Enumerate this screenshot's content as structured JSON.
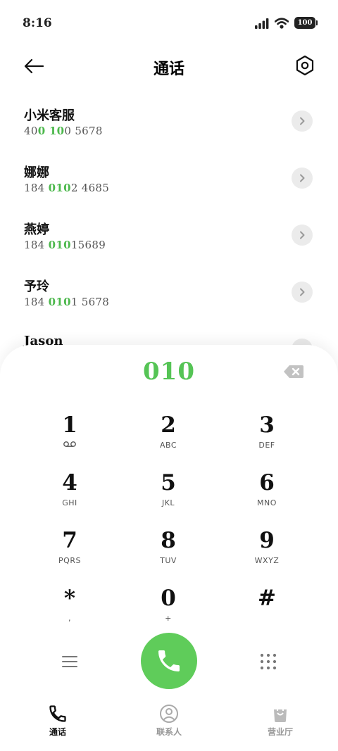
{
  "status_bar": {
    "time": "8:16",
    "battery": "100"
  },
  "header": {
    "title": "通话"
  },
  "results": [
    {
      "name": "小米客服",
      "number_pre": "40",
      "number_match": "0 10",
      "number_post": "0 5678"
    },
    {
      "name": "娜娜",
      "number_pre": "184 ",
      "number_match": "010",
      "number_post": "2 4685"
    },
    {
      "name": "燕婷",
      "number_pre": "184 ",
      "number_match": "010",
      "number_post": "15689"
    },
    {
      "name": "予玲",
      "number_pre": "184 ",
      "number_match": "010",
      "number_post": "1 5678"
    },
    {
      "name": "Jason",
      "number_pre": "",
      "number_match": "",
      "number_post": ""
    }
  ],
  "dialer": {
    "input": "010"
  },
  "keypad": [
    {
      "digit": "1",
      "letters": ""
    },
    {
      "digit": "2",
      "letters": "ABC"
    },
    {
      "digit": "3",
      "letters": "DEF"
    },
    {
      "digit": "4",
      "letters": "GHI"
    },
    {
      "digit": "5",
      "letters": "JKL"
    },
    {
      "digit": "6",
      "letters": "MNO"
    },
    {
      "digit": "7",
      "letters": "PQRS"
    },
    {
      "digit": "8",
      "letters": "TUV"
    },
    {
      "digit": "9",
      "letters": "WXYZ"
    },
    {
      "digit": "*",
      "letters": ","
    },
    {
      "digit": "0",
      "letters": "+"
    },
    {
      "digit": "#",
      "letters": ""
    }
  ],
  "tabs": [
    {
      "label": "通话",
      "icon": "phone-icon",
      "active": true
    },
    {
      "label": "联系人",
      "icon": "contacts-icon",
      "active": false
    },
    {
      "label": "营业厅",
      "icon": "shop-bag-icon",
      "active": false
    }
  ],
  "colors": {
    "accent_green": "#5fcc5a",
    "match_green": "#4cb84c"
  }
}
